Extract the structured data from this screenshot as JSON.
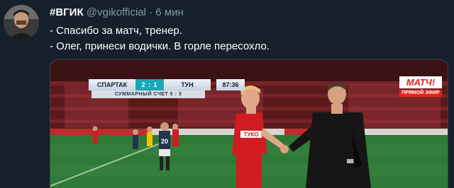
{
  "tweet": {
    "author_name": "#ВГИК",
    "handle": "@vgikofficial",
    "separator": "·",
    "time": "6 мин",
    "lines": [
      "- Спасибо за матч, тренер.",
      "- Олег, принеси водички. В горле пересохло."
    ]
  },
  "media": {
    "scoreboard": {
      "home_team": "СПАРТАК",
      "score": "2 : 1",
      "away_team": "ТУН",
      "clock": "87:36",
      "aggregate": "СУММАРНЫЙ СЧЕТ 5 : 3"
    },
    "broadcaster": {
      "name": "МАТЧ!",
      "badge": "ПРЯМОЙ ЭФИР"
    },
    "jersey_sponsor": "ТУКО",
    "colors": {
      "pitch": "#2e7a36",
      "spartak_red": "#d21a22",
      "brand_red": "#e2231a"
    }
  }
}
